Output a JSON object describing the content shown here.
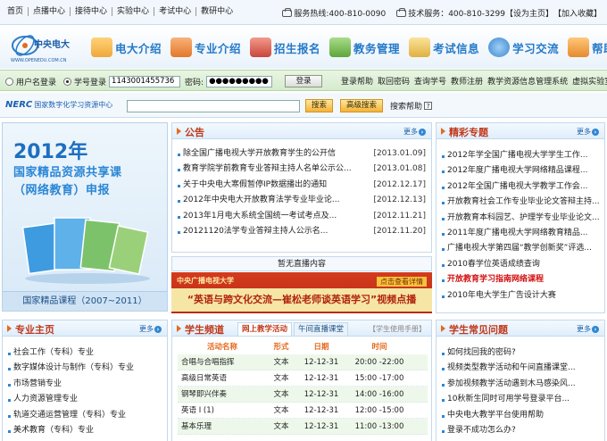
{
  "topbar": {
    "nav": [
      "首页",
      "点播中心",
      "接待中心",
      "实验中心",
      "考试中心",
      "教研中心"
    ],
    "service_hotline": "服务热线:400-810-0090",
    "tech_hotline": "技术服务：400-810-3299",
    "set_home": "【设为主页】",
    "add_fav": "【加入收藏】"
  },
  "header": {
    "logo_cn": "中央电大",
    "logo_url_text": "WWW.OPENEDU.COM.CN",
    "nav": [
      {
        "label": "电大介绍",
        "icon": "school-icon",
        "color": "#f0a83a"
      },
      {
        "label": "专业介绍",
        "icon": "books-icon",
        "color": "#e3772a"
      },
      {
        "label": "招生报名",
        "icon": "enroll-icon",
        "color": "#c9463a"
      },
      {
        "label": "教务管理",
        "icon": "manage-icon",
        "color": "#5ea63a"
      },
      {
        "label": "考试信息",
        "icon": "exam-icon",
        "color": "#e0b040"
      },
      {
        "label": "学习交流",
        "icon": "globe-icon",
        "color": "#3b86cf"
      },
      {
        "label": "帮助",
        "icon": "help-icon",
        "color": "#e68a2e"
      }
    ]
  },
  "login": {
    "role_user": "用户名登录",
    "role_student": "学号登录",
    "student_id": "1143001455736",
    "password_label": "密码:",
    "password_mask": "●●●●●●●●●",
    "login_button": "登录",
    "links": [
      "登录帮助",
      "取回密码",
      "查询学号",
      "教师注册",
      "教学资源信息管理系统",
      "虚拟实验室"
    ]
  },
  "search": {
    "brand": "NERC",
    "brand_sub": "国家数字化学习资源中心",
    "search_button": "搜索",
    "adv_search_button": "高级搜索",
    "help_label": "搜索帮助",
    "help_icon": "?"
  },
  "banner": {
    "year": "2012年",
    "line1": "国家精品资源共享课",
    "line2": "（网络教育）申报",
    "footer": "国家精品课程（2007~2011）"
  },
  "notice": {
    "title": "公告",
    "more": "更多",
    "items": [
      {
        "text": "除全国广播电视大学开放教育学生的公开信",
        "date": "[2013.01.09]"
      },
      {
        "text": "教育学院学前教育专业答辩主持人名单公示公...",
        "date": "[2013.01.08]"
      },
      {
        "text": "关于中央电大寒假暂停IP数据播出的通知",
        "date": "[2012.12.17]"
      },
      {
        "text": "2012年中央电大开放教育法学专业毕业论...",
        "date": "[2012.12.13]"
      },
      {
        "text": "2013年1月电大系统全国统一考试考点及...",
        "date": "[2012.11.21]"
      },
      {
        "text": "20121120法学专业答辩主持人公示名...",
        "date": "[2012.11.20]"
      }
    ]
  },
  "featured": {
    "title": "精彩专题",
    "more": "更多",
    "items": [
      {
        "text": "2012年学全国广播电视大学学生工作...",
        "highlight": false
      },
      {
        "text": "2012年度广播电视大学网络精品课程...",
        "highlight": false
      },
      {
        "text": "2012年全国广播电视大学教学工作会...",
        "highlight": false
      },
      {
        "text": "开放教育社会工作专业毕业论文答辩主持...",
        "highlight": false
      },
      {
        "text": "开放教育本科园艺、护理学专业毕业论文...",
        "highlight": false
      },
      {
        "text": "2011年度广播电视大学网络教育精品...",
        "highlight": false
      },
      {
        "text": "广播电视大学第四届“教学创新奖”评选...",
        "highlight": false
      },
      {
        "text": "2010春学位英语成绩查询",
        "highlight": false
      },
      {
        "text": "开放教育学习指南网络课程",
        "highlight": true
      },
      {
        "text": "2010年电大学生广告设计大赛",
        "highlight": false
      }
    ]
  },
  "live": {
    "no_live": "暂无直播内容",
    "promo_top": "中央广播电视大学",
    "promo_button": "点击查看详情",
    "promo_main": "“英语与跨文化交流—崔松老师谈英语学习”视频点播"
  },
  "majors": {
    "title": "专业主页",
    "more": "更多",
    "items": [
      "社会工作（专科）专业",
      "数字媒体设计与制作（专科）专业",
      "市场营销专业",
      "人力资源管理专业",
      "轨道交通运营管理（专科）专业",
      "美术教育（专科）专业"
    ]
  },
  "channel": {
    "title": "学生频道",
    "tabs": [
      "网上教学活动",
      "午间直播课堂"
    ],
    "manual": "【学生使用手册】",
    "headers": [
      "活动名称",
      "形式",
      "日期",
      "时间"
    ],
    "rows": [
      [
        "合唱与合唱指挥",
        "文本",
        "12-12-31",
        "20:00 -22:00"
      ],
      [
        "高级日常英语",
        "文本",
        "12-12-31",
        "15:00 -17:00"
      ],
      [
        "钢琴即兴伴奏",
        "文本",
        "12-12-31",
        "14:00 -16:00"
      ],
      [
        "英语 I (1)",
        "文本",
        "12-12-31",
        "12:00 -15:00"
      ],
      [
        "基本乐理",
        "文本",
        "12-12-31",
        "11:00 -13:00"
      ]
    ]
  },
  "faq": {
    "title": "学生常见问题",
    "more": "更多",
    "items": [
      "如何找回我的密码?",
      "视频类型教学活动和午间直播课堂...",
      "参加视频教学活动遇到木马感染风...",
      "10秋新生同时可用学号登录平台...",
      "中央电大教学平台使用帮助",
      "登录不成功怎么办?"
    ]
  }
}
